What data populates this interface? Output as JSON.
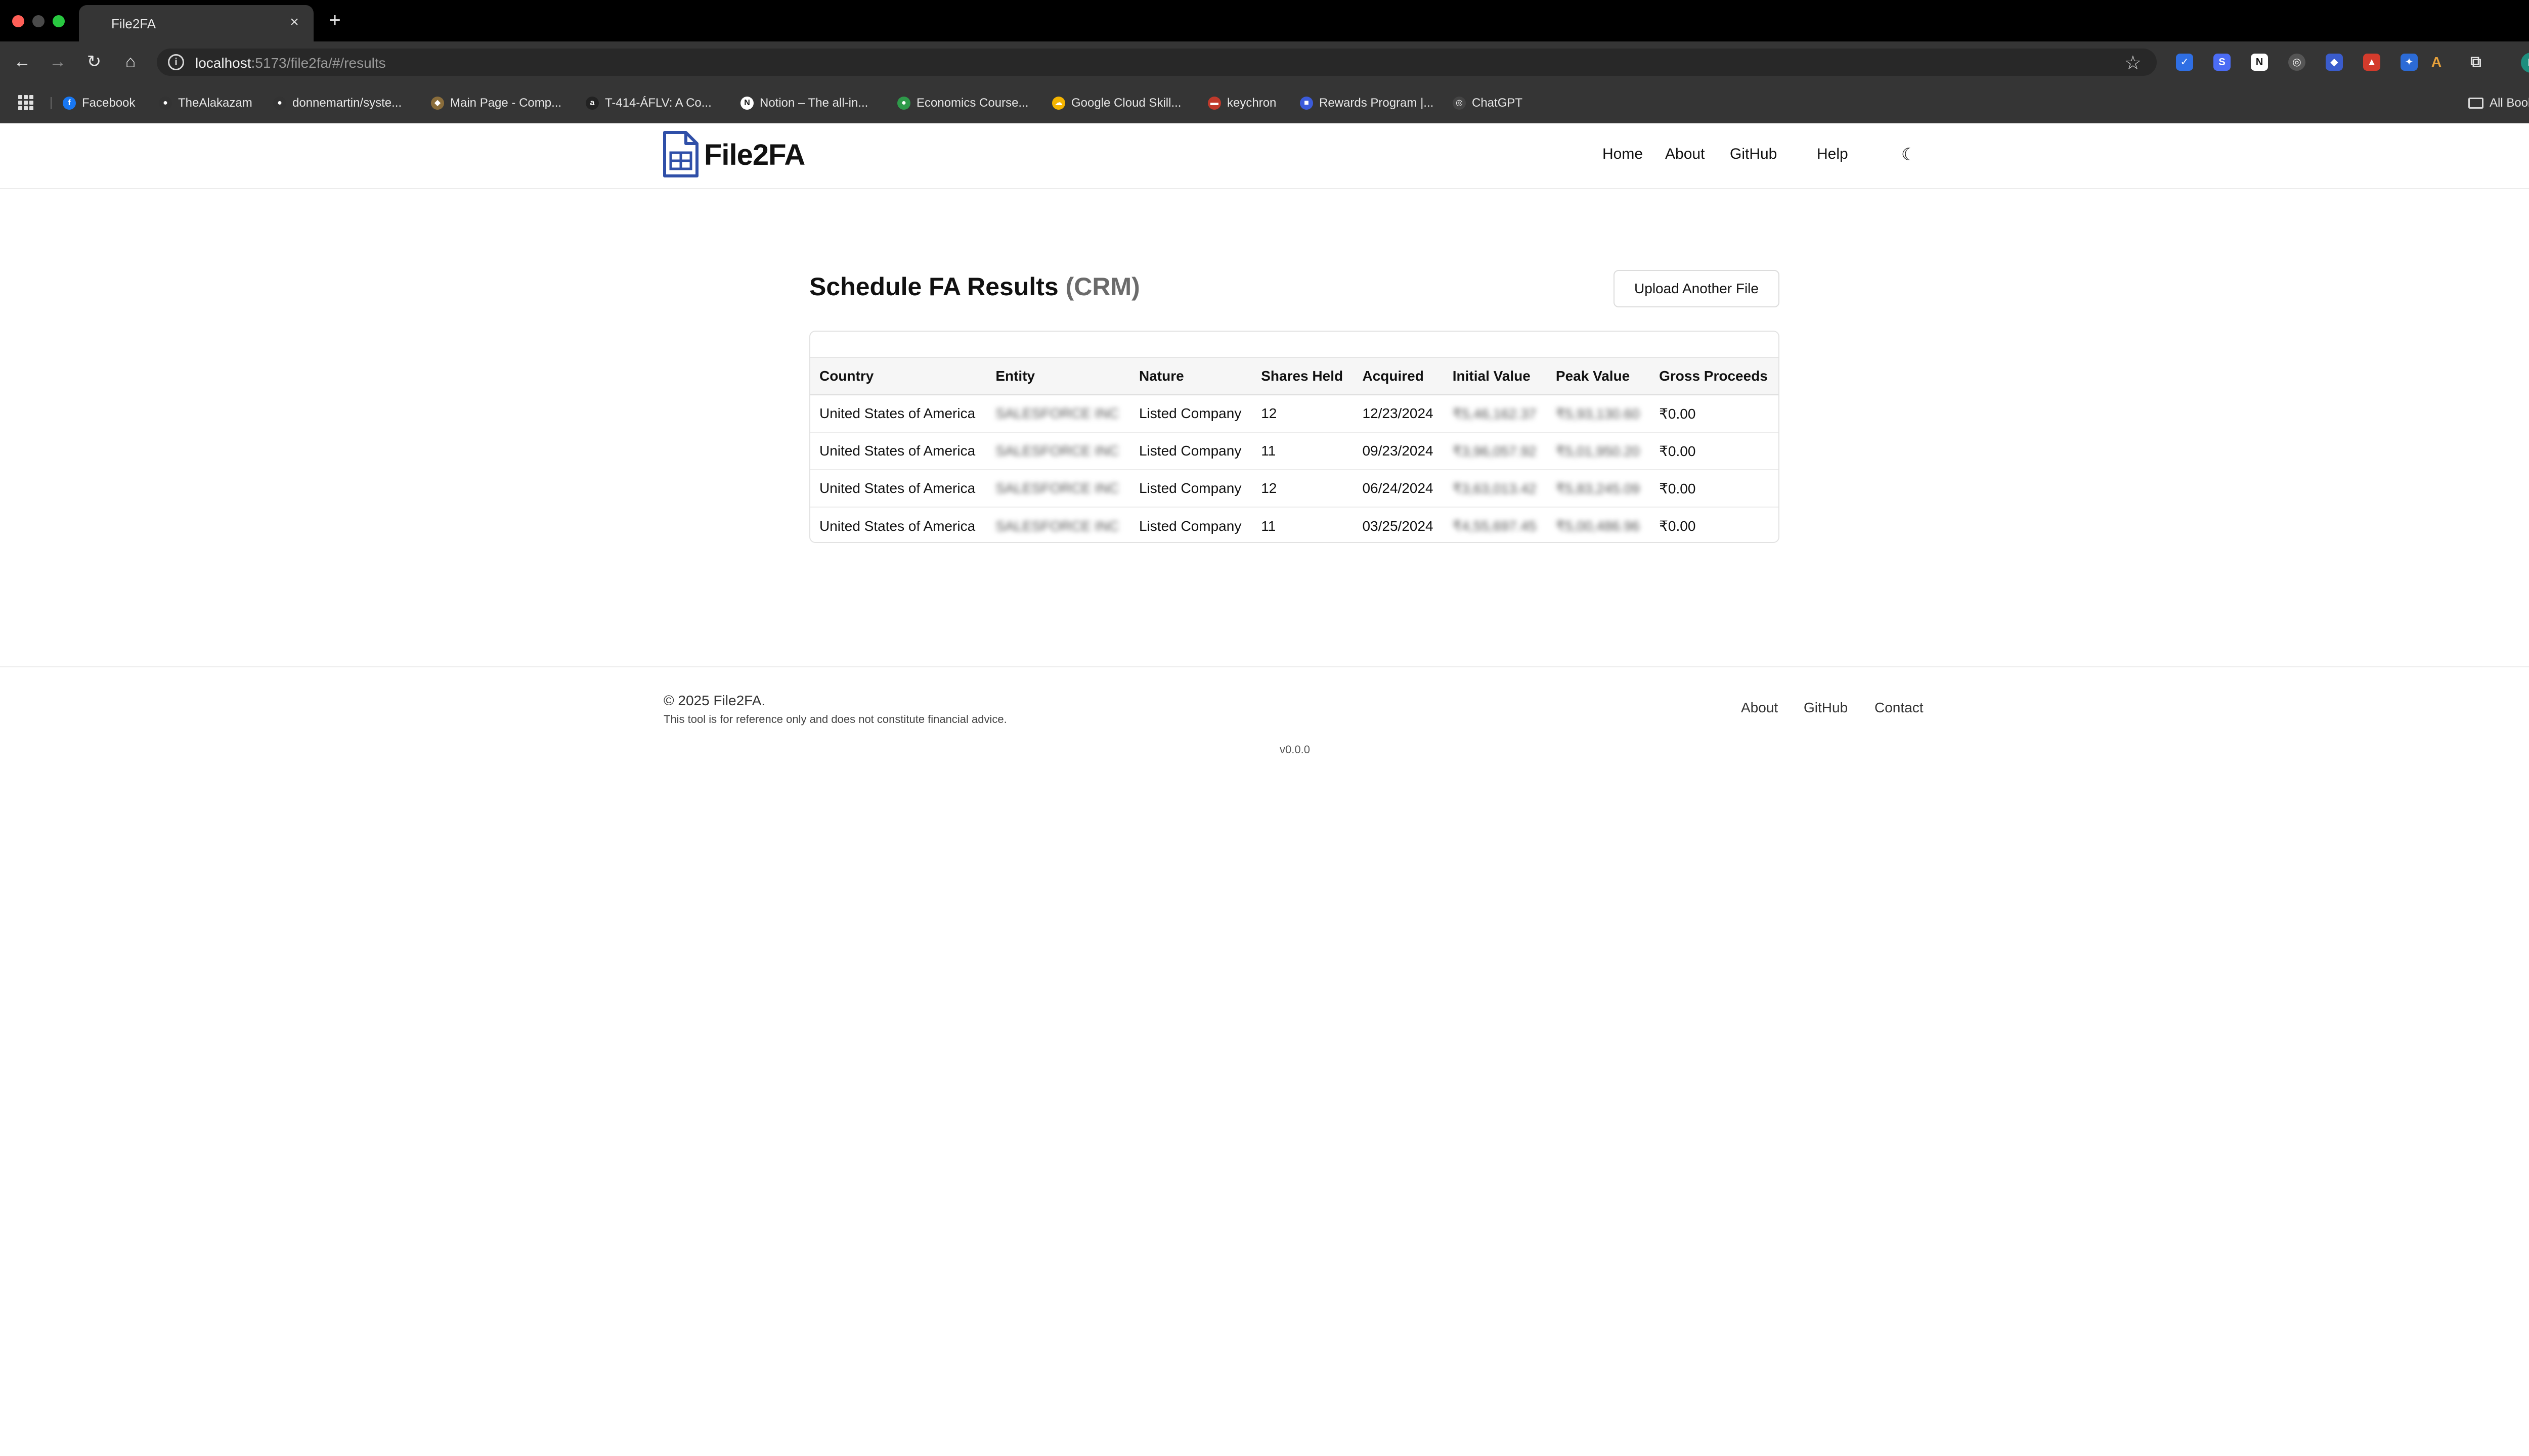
{
  "browser": {
    "tab_title": "File2FA",
    "tab_close": "×",
    "new_tab": "+",
    "url_host": "localhost",
    "url_path": ":5173/file2fa/#/results",
    "bookmarks": [
      {
        "label": "Facebook",
        "icon": "facebook-icon",
        "color": "#1877f2",
        "glyph": "f"
      },
      {
        "label": "TheAlakazam",
        "icon": "github-icon",
        "color": "#333333",
        "glyph": "●"
      },
      {
        "label": "donnemartin/syste...",
        "icon": "github-icon",
        "color": "#333333",
        "glyph": "●"
      },
      {
        "label": "Main Page - Comp...",
        "icon": "wiki-icon",
        "color": "#8a6d3b",
        "glyph": "◆"
      },
      {
        "label": "T-414-ÁFLV: A Co...",
        "icon": "amazon-icon",
        "color": "#222222",
        "glyph": "a"
      },
      {
        "label": "Notion – The all-in...",
        "icon": "notion-icon",
        "color": "#ffffff",
        "glyph": "N"
      },
      {
        "label": "Economics Course...",
        "icon": "course-icon",
        "color": "#2e9a4a",
        "glyph": "●"
      },
      {
        "label": "Google Cloud Skill...",
        "icon": "google-cloud-icon",
        "color": "#f4b400",
        "glyph": "☁"
      },
      {
        "label": "keychron",
        "icon": "keychron-icon",
        "color": "#c0392b",
        "glyph": "▬"
      },
      {
        "label": "Rewards Program |...",
        "icon": "rewards-icon",
        "color": "#3b5bdb",
        "glyph": "■"
      },
      {
        "label": "ChatGPT",
        "icon": "chatgpt-icon",
        "color": "#444444",
        "glyph": "◎"
      }
    ],
    "all_bookmarks": "All Bookmarks"
  },
  "site": {
    "brand": "File2FA",
    "nav": [
      "Home",
      "About",
      "GitHub",
      "Help"
    ]
  },
  "results": {
    "title": "Schedule FA Results",
    "title_suffix": "(CRM)",
    "upload_button": "Upload Another File",
    "columns": [
      "Country",
      "Entity",
      "Nature",
      "Shares Held",
      "Acquired",
      "Initial Value",
      "Peak Value",
      "Gross Proceeds"
    ],
    "rows": [
      {
        "country": "United States of America",
        "entity": "SALESFORCE INC",
        "nature": "Listed Company",
        "shares": "12",
        "acquired": "12/23/2024",
        "initial": "₹5,46,162.37",
        "peak": "₹5,93,130.60",
        "gross": "₹0.00"
      },
      {
        "country": "United States of America",
        "entity": "SALESFORCE INC",
        "nature": "Listed Company",
        "shares": "11",
        "acquired": "09/23/2024",
        "initial": "₹3,96,057.92",
        "peak": "₹5,01,950.20",
        "gross": "₹0.00"
      },
      {
        "country": "United States of America",
        "entity": "SALESFORCE INC",
        "nature": "Listed Company",
        "shares": "12",
        "acquired": "06/24/2024",
        "initial": "₹3,63,013.42",
        "peak": "₹5,83,245.09",
        "gross": "₹0.00"
      },
      {
        "country": "United States of America",
        "entity": "SALESFORCE INC",
        "nature": "Listed Company",
        "shares": "11",
        "acquired": "03/25/2024",
        "initial": "₹4,55,697.45",
        "peak": "₹5,00,486.96",
        "gross": "₹0.00"
      }
    ]
  },
  "footer": {
    "copyright": "© 2025 File2FA.",
    "disclaimer": "This tool is for reference only and does not constitute financial advice.",
    "links": [
      "About",
      "GitHub",
      "Contact"
    ],
    "version": "v0.0.0"
  }
}
